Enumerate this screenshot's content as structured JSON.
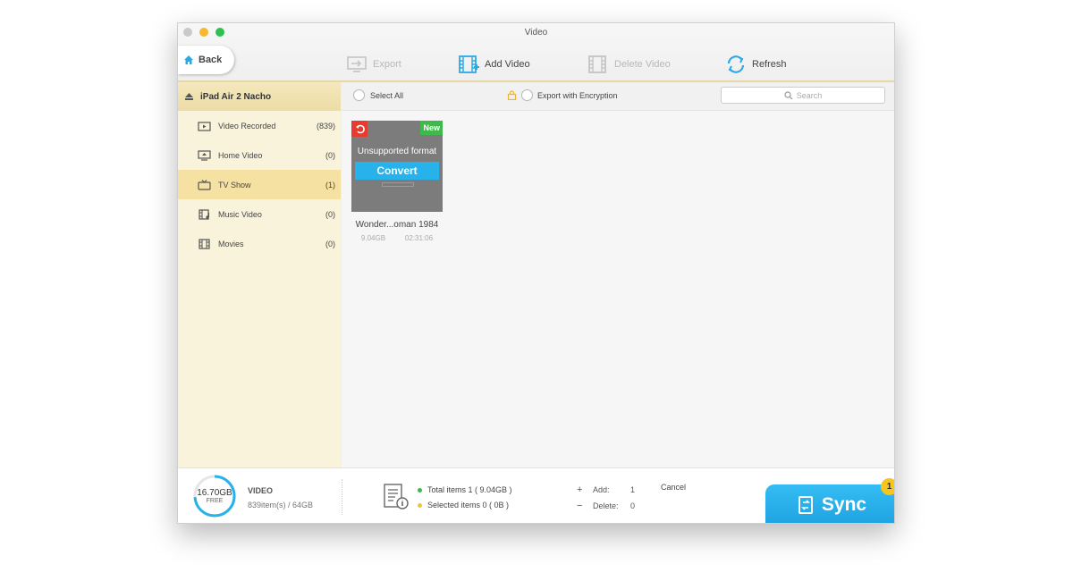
{
  "window": {
    "title": "Video"
  },
  "toolbar": {
    "back_label": "Back",
    "export_label": "Export",
    "add_video_label": "Add Video",
    "delete_video_label": "Delete Video",
    "refresh_label": "Refresh"
  },
  "sidebar": {
    "device_name": "iPad Air 2 Nacho",
    "items": [
      {
        "label": "Video Recorded",
        "count": "(839)",
        "icon": "video-camera-icon",
        "active": false
      },
      {
        "label": "Home Video",
        "count": "(0)",
        "icon": "monitor-icon",
        "active": false
      },
      {
        "label": "TV Show",
        "count": "(1)",
        "icon": "tv-icon",
        "active": true
      },
      {
        "label": "Music Video",
        "count": "(0)",
        "icon": "music-video-icon",
        "active": false
      },
      {
        "label": "Movies",
        "count": "(0)",
        "icon": "film-icon",
        "active": false
      }
    ]
  },
  "main": {
    "select_all_label": "Select All",
    "export_encryption_label": "Export with Encryption",
    "search_placeholder": "Search",
    "videos": [
      {
        "title": "Wonder...oman 1984",
        "size": "9.04GB",
        "duration": "02:31:06",
        "badge": "New",
        "status": "Unsupported format",
        "action": "Convert"
      }
    ]
  },
  "footer": {
    "storage_free": "16.70GB",
    "storage_free_label": "FREE",
    "storage_used_fraction": 0.74,
    "category_label": "VIDEO",
    "category_usage": "839item(s) / 64GB",
    "total_items": "Total items 1 ( 9.04GB )",
    "selected_items": "Selected items 0 ( 0B )",
    "add_sign": "+",
    "add_label": "Add:",
    "add_count": "1",
    "delete_sign": "−",
    "delete_label": "Delete:",
    "delete_count": "0",
    "cancel_label": "Cancel",
    "sync_label": "Sync",
    "sync_badge": "1"
  },
  "colors": {
    "accent_blue": "#27b2ec",
    "sidebar_bg": "#faf3dc",
    "active_item": "#f5e2a3",
    "new_badge": "#3fb94b",
    "undo_badge": "#e63b2e",
    "total_dot": "#3fb94b",
    "selected_dot": "#f2c530"
  }
}
